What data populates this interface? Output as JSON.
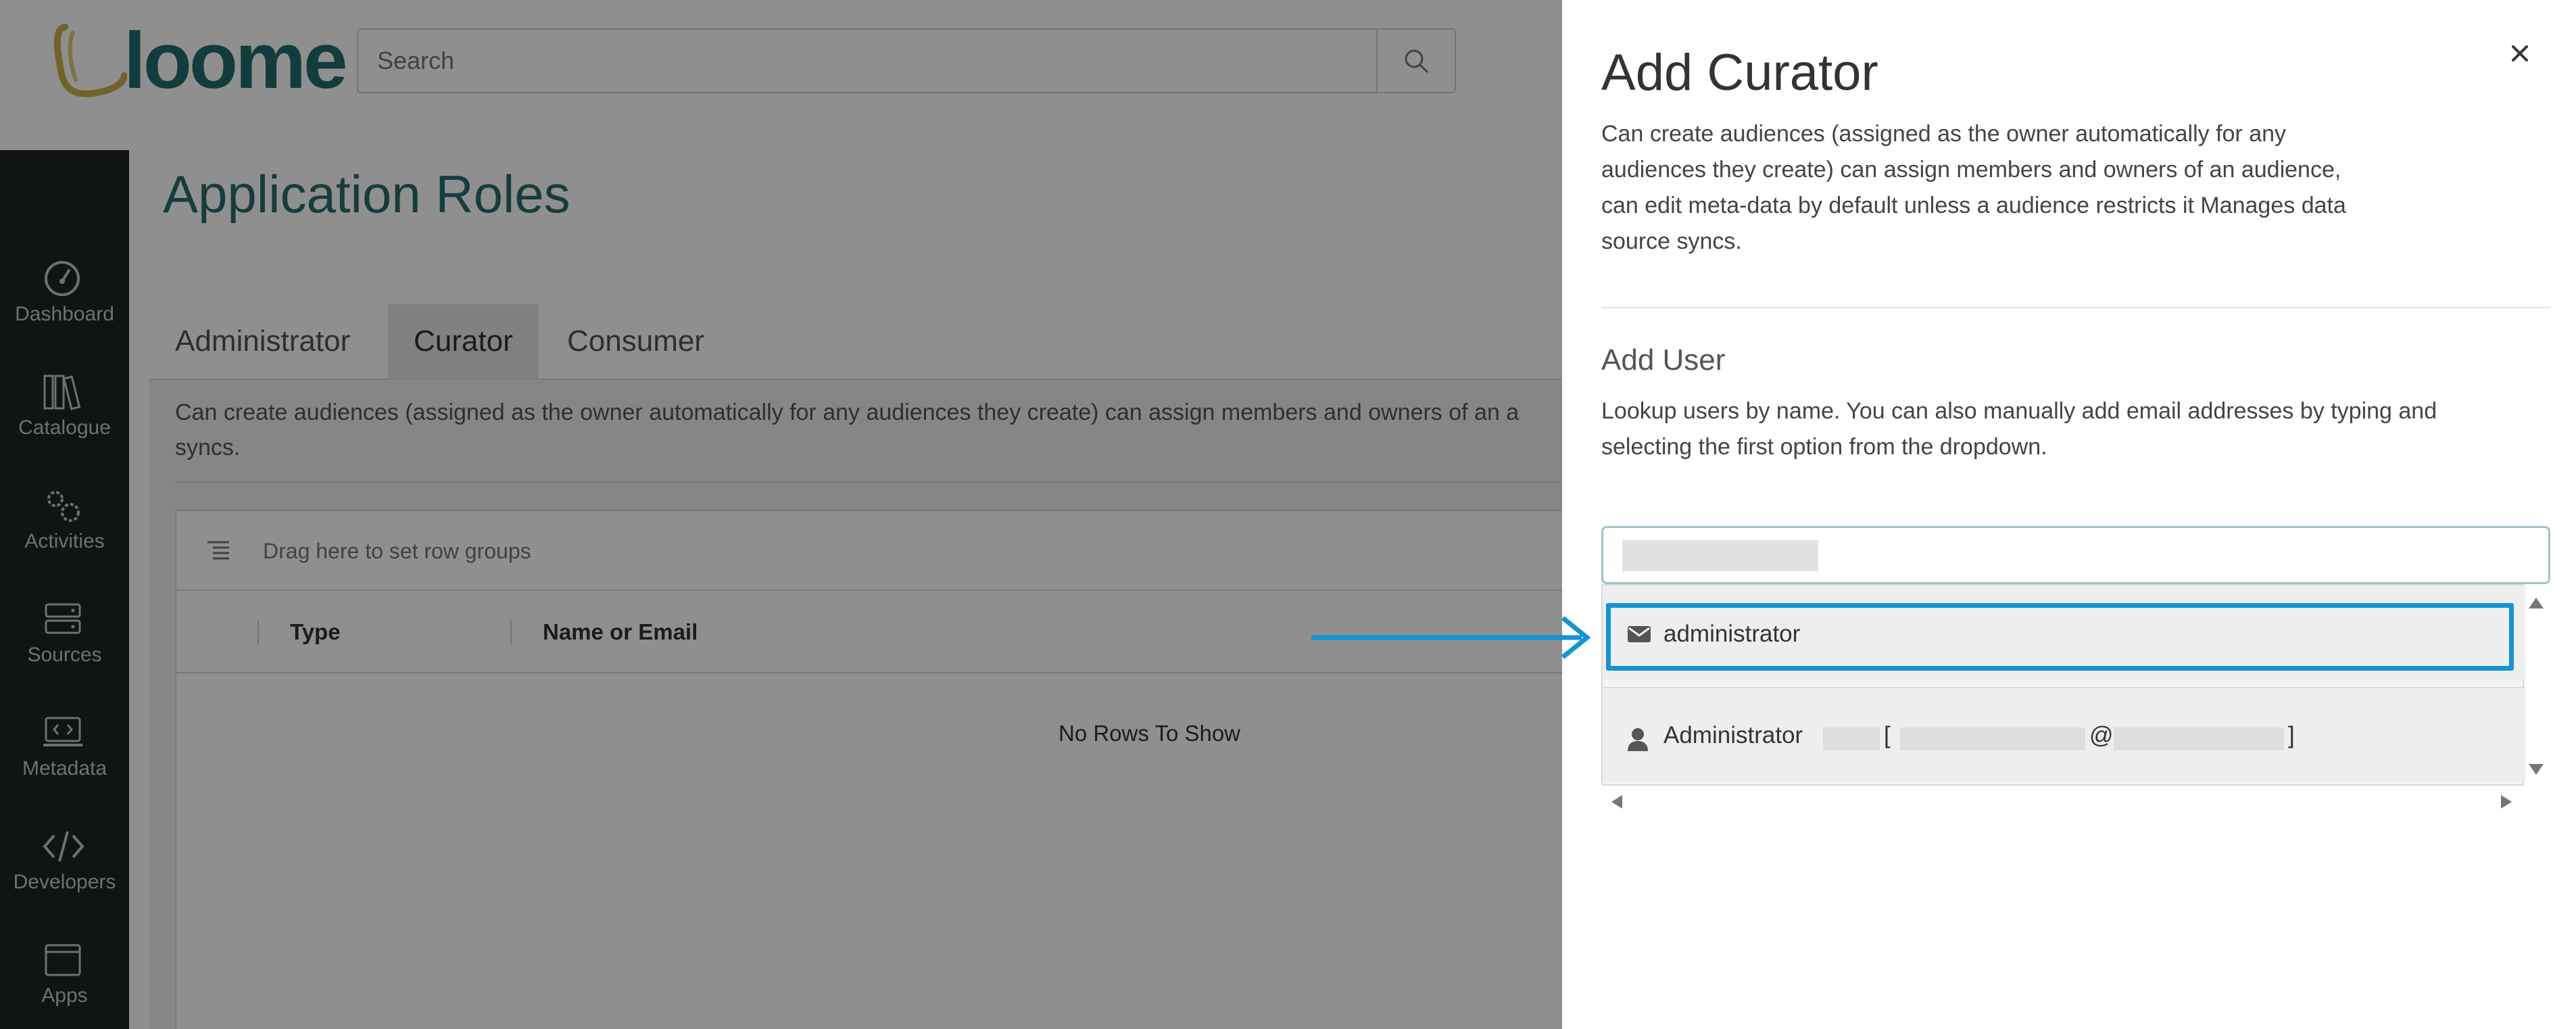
{
  "app": {
    "logo_text": "loome",
    "search": {
      "placeholder": "Search"
    },
    "sidebar": {
      "items": [
        {
          "label": "Dashboard",
          "icon": "dashboard-icon"
        },
        {
          "label": "Catalogue",
          "icon": "catalogue-icon"
        },
        {
          "label": "Activities",
          "icon": "activities-icon"
        },
        {
          "label": "Sources",
          "icon": "sources-icon"
        },
        {
          "label": "Metadata",
          "icon": "metadata-icon"
        },
        {
          "label": "Developers",
          "icon": "developers-icon"
        },
        {
          "label": "Apps",
          "icon": "apps-icon"
        }
      ]
    },
    "page_title": "Application Roles",
    "tabs": [
      {
        "label": "Administrator",
        "active": false
      },
      {
        "label": "Curator",
        "active": true
      },
      {
        "label": "Consumer",
        "active": false
      }
    ],
    "panel_description": "Can create audiences (assigned as the owner automatically for any audiences they create) can assign members and owners of an a",
    "panel_description_tail": "syncs.",
    "grid": {
      "group_bar_label": "Drag here to set row groups",
      "columns": [
        "Type",
        "Name or Email"
      ],
      "empty_message": "No Rows To Show"
    }
  },
  "drawer": {
    "title": "Add Curator",
    "description_lines": [
      "Can create audiences (assigned as the owner automatically for any",
      "audiences they create) can assign members and owners of an audience,",
      "can edit meta-data by default unless a audience restricts it Manages data",
      "source syncs."
    ],
    "section_title": "Add User",
    "section_desc_lines": [
      "Lookup users by name. You can also manually add email addresses by typing and",
      "selecting the first option from the dropdown."
    ],
    "options": [
      {
        "label": "administrator",
        "icon": "envelope-icon",
        "highlighted": true
      },
      {
        "label": "Administrator",
        "icon": "user-icon",
        "bracket_open": "[",
        "at": "@",
        "bracket_close": "]"
      }
    ]
  },
  "colors": {
    "brand_teal": "#1f6e6d",
    "sidebar_bg": "#1e2426",
    "highlight_blue": "#1593d3",
    "input_focus_border": "#9fc3c8"
  }
}
